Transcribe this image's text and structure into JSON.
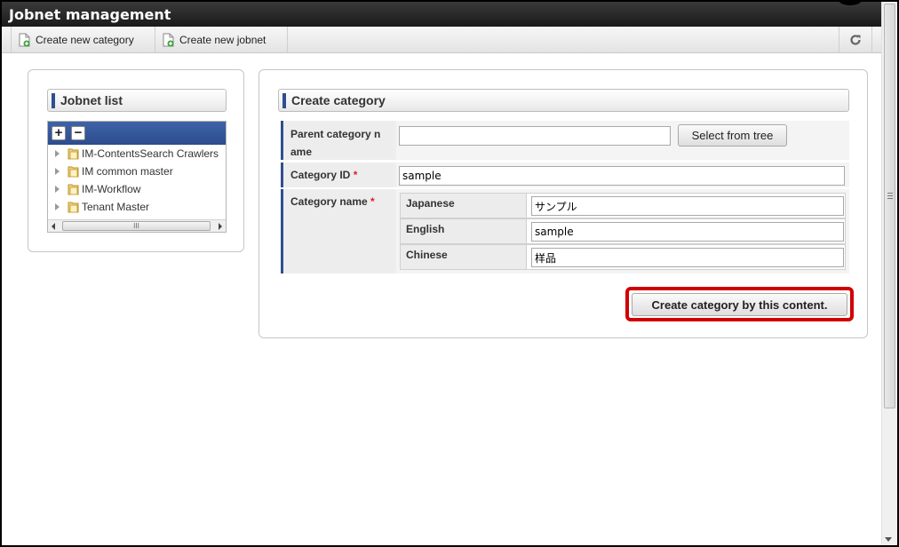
{
  "window": {
    "title": "Jobnet management"
  },
  "toolbar": {
    "create_category_label": "Create new category",
    "create_jobnet_label": "Create new jobnet",
    "refresh_icon": "refresh-icon"
  },
  "jobnet_list": {
    "header": "Jobnet list",
    "expand_label": "+",
    "collapse_label": "−",
    "items": [
      {
        "label": "IM-ContentsSearch Crawlers"
      },
      {
        "label": "IM common master"
      },
      {
        "label": "IM-Workflow"
      },
      {
        "label": "Tenant Master"
      }
    ],
    "scroll_grip": "III"
  },
  "create_category": {
    "header": "Create category",
    "parent_category": {
      "label_line1": "Parent category n",
      "label_line2": "ame",
      "value": "",
      "select_button": "Select from tree"
    },
    "category_id": {
      "label": "Category ID",
      "required_mark": "*",
      "value": "sample"
    },
    "category_name": {
      "label": "Category name",
      "required_mark": "*",
      "languages": [
        {
          "label": "Japanese",
          "value": "サンプル"
        },
        {
          "label": "English",
          "value": "sample"
        },
        {
          "label": "Chinese",
          "value": "样品"
        }
      ]
    },
    "submit_button": "Create category by this content."
  },
  "colors": {
    "title_bar": "#1a1a1a",
    "accent_blue": "#304e8f",
    "highlight_red": "#d00000",
    "required_red": "#e02020"
  }
}
